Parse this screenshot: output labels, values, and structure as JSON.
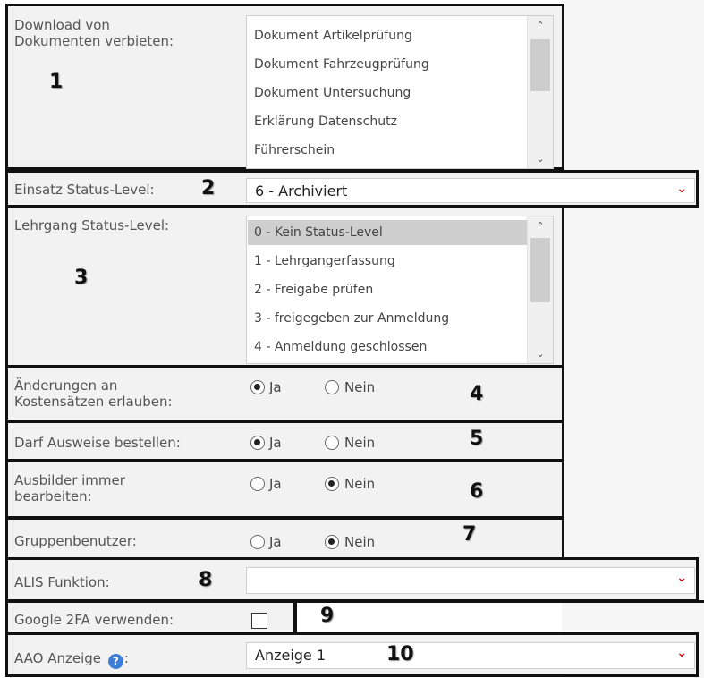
{
  "download": {
    "label": "Download von\nDokumenten verbieten:",
    "marker": "1",
    "items": [
      "Dokument Artikelprüfung",
      "Dokument Fahrzeugprüfung",
      "Dokument Untersuchung",
      "Erklärung Datenschutz",
      "Führerschein"
    ],
    "scroll_up": "⌃",
    "scroll_down": "⌄"
  },
  "einsatz": {
    "label": "Einsatz Status-Level:",
    "marker": "2",
    "value": "6 - Archiviert",
    "chevron": "⌄"
  },
  "lehrgang": {
    "label": "Lehrgang Status-Level:",
    "marker": "3",
    "items": [
      "0 - Kein Status-Level",
      "1 - Lehrgangerfassung",
      "2 - Freigabe prüfen",
      "3 - freigegeben zur Anmeldung",
      "4 - Anmeldung geschlossen"
    ],
    "selected_index": 0,
    "scroll_up": "⌃",
    "scroll_down": "⌄"
  },
  "kosten": {
    "label": "Änderungen an\nKostensätzen erlauben:",
    "marker": "4",
    "ja": "Ja",
    "nein": "Nein",
    "selected": "Ja"
  },
  "ausweise": {
    "label": "Darf Ausweise bestellen:",
    "marker": "5",
    "ja": "Ja",
    "nein": "Nein",
    "selected": "Ja"
  },
  "ausbilder": {
    "label": "Ausbilder immer\nbearbeiten:",
    "marker": "6",
    "ja": "Ja",
    "nein": "Nein",
    "selected": "Nein"
  },
  "gruppen": {
    "label": "Gruppenbenutzer:",
    "marker": "7",
    "ja": "Ja",
    "nein": "Nein",
    "selected": "Nein"
  },
  "alis": {
    "label": "ALIS Funktion:",
    "marker": "8",
    "value": "",
    "chevron": "⌄"
  },
  "google": {
    "label": "Google 2FA verwenden:",
    "marker": "9",
    "checked": false
  },
  "aao": {
    "label": "AAO Anzeige",
    "label_suffix": ":",
    "help_icon": "question-icon",
    "help_glyph": "?",
    "marker": "10",
    "value": "Anzeige 1",
    "chevron": "⌄"
  }
}
